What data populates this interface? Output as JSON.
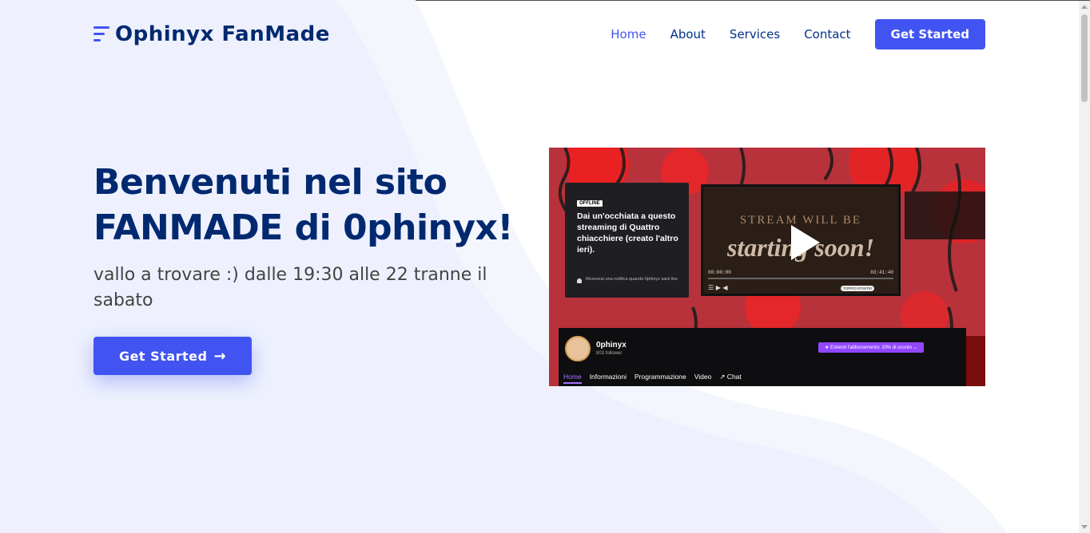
{
  "brand": {
    "name": "Ophinyx FanMade"
  },
  "nav": {
    "items": [
      {
        "label": "Home",
        "active": true
      },
      {
        "label": "About",
        "active": false
      },
      {
        "label": "Services",
        "active": false
      },
      {
        "label": "Contact",
        "active": false
      }
    ],
    "cta": "Get Started"
  },
  "hero": {
    "title_line1": "Benvenuti nel sito",
    "title_line2": "FANMADE di 0phinyx!",
    "subtitle": "vallo a trovare :) dalle 19:30 alle 22 tranne il sabato",
    "button": "Get Started",
    "button_arrow": "→"
  },
  "stream_image": {
    "offline_badge": "OFFLINE",
    "offline_text": "Dai un'occhiata a questo streaming di Quattro chiacchiere (creato l'altro ieri).",
    "notify_text": "Riceverai una notifica quando 0phinyx sarà live",
    "player_top": "STREAM WILL BE",
    "player_big": "starting soon!",
    "time_start": "00:00:00",
    "time_end": "03:41:40",
    "pill": "TOPPIO IPONTEI",
    "channel_name": "0phinyx",
    "followers": "803 follower",
    "subscribe": "★ Estendi l'abbonamento: 20% di sconto ⌄",
    "tabs": [
      "Home",
      "Informazioni",
      "Programmazione",
      "Video",
      "↗ Chat"
    ]
  },
  "colors": {
    "accent": "#4154f1",
    "heading": "#012970",
    "nav_text": "#013289",
    "body_text": "#444444",
    "hero_bg": "#eef1fd"
  }
}
